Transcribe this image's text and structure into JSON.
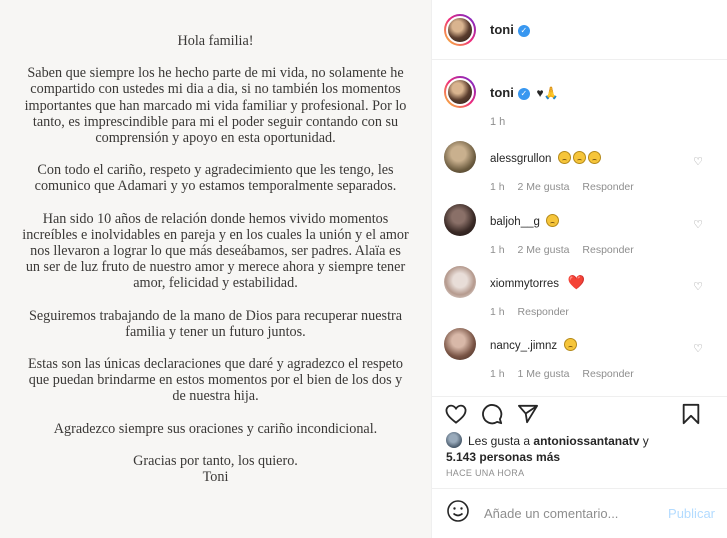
{
  "letter": {
    "greeting": "Hola familia!",
    "paragraphs": [
      "Saben que siempre los he hecho parte de mi vida, no solamente he compartido con ustedes mi dia a dia, si no también los momentos importantes que han marcado mi vida familiar y profesional. Por lo tanto, es imprescindible para mi el poder seguir contando con su comprensión y apoyo en esta oportunidad.",
      "Con todo el cariño, respeto y agradecimiento que les tengo, les comunico que Adamari y yo estamos temporalmente separados.",
      "Han sido 10 años de relación donde hemos vivido momentos increíbles e inolvidables en pareja y en los cuales la unión y el amor nos llevaron a lograr lo que más deseábamos, ser padres. Alaïa es un ser de luz fruto de nuestro amor y merece ahora y siempre tener amor, felicidad y estabilidad.",
      "Seguiremos trabajando de la mano de Dios para recuperar nuestra familia y tener un futuro juntos.",
      "Estas son las únicas declaraciones que daré y agradezco el respeto que puedan brindarme en estos momentos por el bien de los dos y de nuestra hija.",
      "Agradezco siempre sus oraciones y cariño incondicional."
    ],
    "closing": "Gracias por tanto, los quiero.",
    "signature": "Toni"
  },
  "header": {
    "username": "toni"
  },
  "caption": {
    "username": "toni",
    "text": "♥🙏",
    "time": "1 h"
  },
  "comments": [
    {
      "user": "alessgrullon",
      "emoji": "😥😥😥",
      "time": "1 h",
      "likes": "2 Me gusta",
      "reply": "Responder"
    },
    {
      "user": "baljoh__g",
      "emoji": "😥",
      "time": "1 h",
      "likes": "2 Me gusta",
      "reply": "Responder"
    },
    {
      "user": "xiommytorres",
      "emoji": "❤️",
      "time": "1 h",
      "likes": "",
      "reply": "Responder"
    },
    {
      "user": "nancy_.jimnz",
      "emoji": "😥",
      "time": "1 h",
      "likes": "1 Me gusta",
      "reply": "Responder"
    }
  ],
  "likes": {
    "prefix": "Les gusta a",
    "user": "antoniossantanatv",
    "mid": "y",
    "count": "5.143 personas más"
  },
  "post_time": "HACE UNA HORA",
  "add_comment": {
    "placeholder": "Añade un comentario...",
    "post_label": "Publicar"
  },
  "colors": {
    "accent_blue": "#3897f0",
    "post_disabled": "#b3dbff",
    "meta_gray": "#8e8e8e"
  }
}
